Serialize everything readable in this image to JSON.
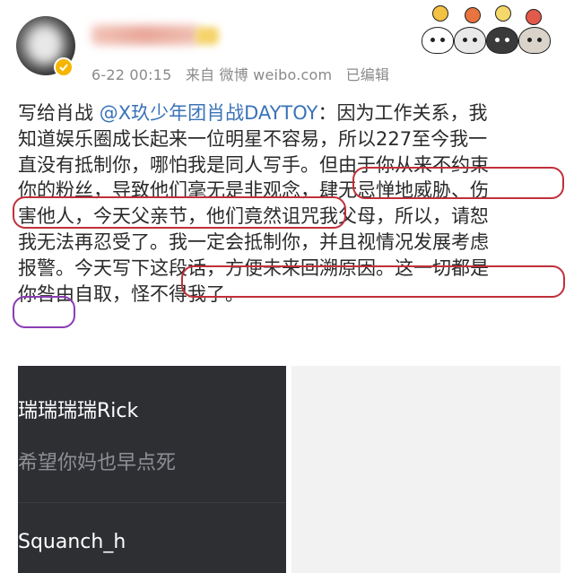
{
  "header": {
    "meta_date": "6-22 00:15",
    "meta_source": "来自 微博 weibo.com",
    "meta_edited": "已编辑"
  },
  "post": {
    "lines": [
      {
        "parts": [
          {
            "t": "写给肖战 "
          },
          {
            "t": "@X玖少年团肖战DAYTOY",
            "mention": true
          },
          {
            "t": "：因为工作关系，我"
          }
        ]
      },
      {
        "parts": [
          {
            "t": "知道娱乐圈成长起来一位明星不容易，所以227至今我一"
          }
        ]
      },
      {
        "parts": [
          {
            "t": "直没有抵制你，哪怕我是同人写手。但由于你从来不约束"
          }
        ]
      },
      {
        "parts": [
          {
            "t": "你的粉丝，导致他们毫无是非观念，肆无忌惮地威胁、伤"
          }
        ]
      },
      {
        "parts": [
          {
            "t": "害他人，今天父亲节，他们竟然诅咒我父母，所以，请恕"
          }
        ]
      },
      {
        "parts": [
          {
            "t": "我无法再忍受了。我一定会抵制你，并且视情况发展考虑"
          }
        ]
      },
      {
        "parts": [
          {
            "t": "报警。今天写下这段话，方便未来回溯原因。这一切都是"
          }
        ]
      },
      {
        "parts": [
          {
            "t": "你咎由自取，怪不得我了。"
          }
        ]
      }
    ]
  },
  "comments": [
    {
      "user": "瑞瑞瑞瑞Rick",
      "text": "希望你妈也早点死"
    },
    {
      "user": "Squanch_h",
      "text": ""
    }
  ],
  "colors": {
    "mention": "#3a73b8",
    "annotation_red": "#c0303a",
    "annotation_purple": "#8a3cb4",
    "comment_bg": "#2d2f33"
  },
  "icons": [
    "avatar",
    "verified-badge-icon",
    "sticker-cats"
  ]
}
